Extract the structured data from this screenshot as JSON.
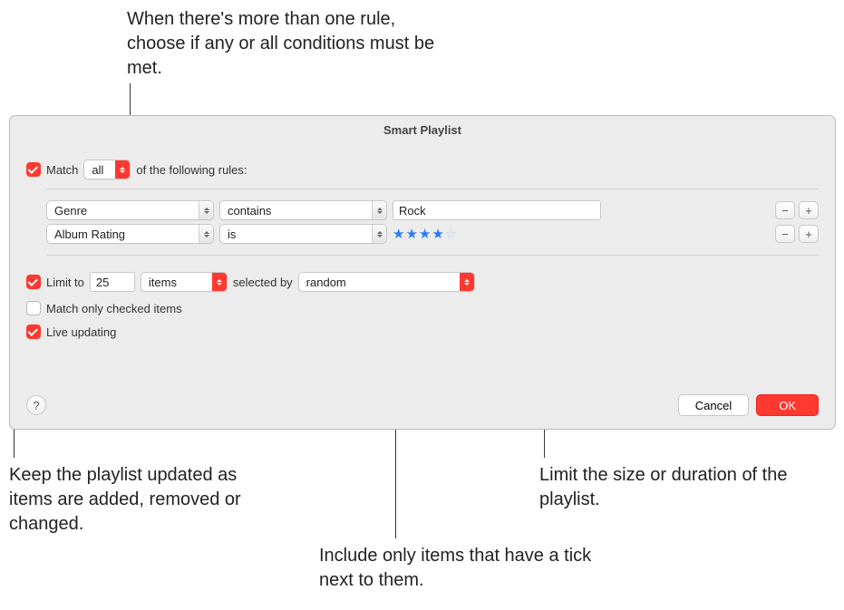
{
  "callouts": {
    "top": "When there's more than one rule, choose if any or all conditions must be met.",
    "live": "Keep the playlist updated as items are added, removed or changed.",
    "checked": "Include only items that have a tick next to them.",
    "limit": "Limit the size or duration of the playlist."
  },
  "dialog": {
    "title": "Smart Playlist",
    "match_label_pre": "Match",
    "match_mode": "all",
    "match_label_post": "of the following rules:",
    "rules": [
      {
        "field": "Genre",
        "op": "contains",
        "value": "Rock",
        "type": "text"
      },
      {
        "field": "Album Rating",
        "op": "is",
        "value": 4,
        "type": "stars"
      }
    ],
    "limit": {
      "label": "Limit to",
      "count": "25",
      "unit": "items",
      "selected_by_label": "selected by",
      "selected_by": "random"
    },
    "match_checked": "Match only checked items",
    "live_updating": "Live updating",
    "buttons": {
      "cancel": "Cancel",
      "ok": "OK",
      "help": "?"
    },
    "pm": {
      "minus": "−",
      "plus": "+"
    }
  }
}
